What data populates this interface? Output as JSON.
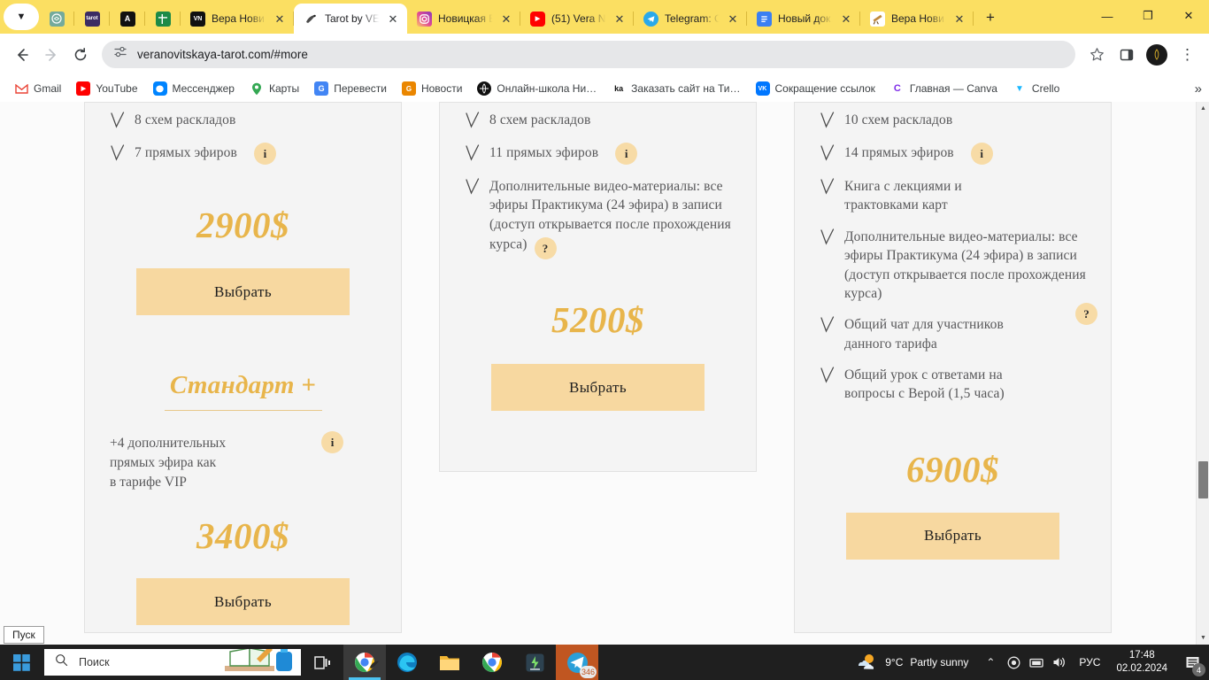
{
  "browser": {
    "tab_list_dropdown": "tab-search",
    "mini_tabs": [
      {
        "name": "chatgpt",
        "letter": "",
        "bg": "#74aa9c"
      },
      {
        "name": "notion-dark",
        "letter": "",
        "bg": "#3b2c63"
      },
      {
        "name": "adobe-acrobat",
        "letter": "A",
        "bg": "#111111"
      },
      {
        "name": "excel",
        "letter": "",
        "bg": "#1d8a47"
      }
    ],
    "tabs": [
      {
        "title": "Вера Нови…",
        "favicon_letter": "VN",
        "favicon_bg": "#111111",
        "active": false
      },
      {
        "title": "Tarot by VE…",
        "favicon_letter": "",
        "favicon_bg": "#ffffff",
        "active": true
      },
      {
        "title": "Новицкая В…",
        "favicon_letter": "",
        "favicon_bg": "#e1306c",
        "active": false
      },
      {
        "title": "(51) Vera N…",
        "favicon_letter": "",
        "favicon_bg": "#ff0000",
        "active": false
      },
      {
        "title": "Telegram: C…",
        "favicon_letter": "",
        "favicon_bg": "#29a9eb",
        "active": false
      },
      {
        "title": "Новый док…",
        "favicon_letter": "",
        "favicon_bg": "#3b7ff2",
        "active": false
      },
      {
        "title": "Вера Нови…",
        "favicon_letter": "",
        "favicon_bg": "#ffffff",
        "active": false
      }
    ],
    "tab_close_glyph": "✕",
    "new_tab_glyph": "+",
    "window_controls": {
      "minimize": "—",
      "maximize": "❐",
      "close": "✕"
    },
    "nav": {
      "back": "←",
      "forward": "→",
      "reload": "⟳"
    },
    "omnibox": {
      "url": "veranovitskaya-tarot.com/#more",
      "site_settings_icon": "tune-icon",
      "star": "☆"
    },
    "side_panel_icon": "side-panel-icon",
    "menu_icon": "⋮",
    "bookmarks": [
      {
        "label": "Gmail",
        "letter": "M",
        "bg": "#ffffff",
        "color": "#ea4335"
      },
      {
        "label": "YouTube",
        "letter": "▶",
        "bg": "#ff0000",
        "color": "#ffffff"
      },
      {
        "label": "Мессенджер",
        "letter": "",
        "bg": "#ffffff",
        "color": "#0084ff"
      },
      {
        "label": "Карты",
        "letter": "",
        "bg": "#ffffff",
        "color": "#34a853"
      },
      {
        "label": "Перевести",
        "letter": "G",
        "bg": "#4285f4",
        "color": "#ffffff"
      },
      {
        "label": "Новости",
        "letter": "G",
        "bg": "#ea8600",
        "color": "#ffffff"
      },
      {
        "label": "Онлайн-школа Ни…",
        "letter": "",
        "bg": "#111111",
        "color": "#ffffff"
      },
      {
        "label": "Заказать сайт на Ти…",
        "letter": "ka",
        "bg": "#ffffff",
        "color": "#111111"
      },
      {
        "label": "Сокращение ссылок",
        "letter": "VK",
        "bg": "#0077ff",
        "color": "#ffffff"
      },
      {
        "label": "Главная — Canva",
        "letter": "C",
        "bg": "#ffffff",
        "color": "#7d2ae8"
      },
      {
        "label": "Crello",
        "letter": "▼",
        "bg": "#ffffff",
        "color": "#1ab7ff"
      }
    ],
    "bookmarks_overflow": "»"
  },
  "page": {
    "colors": {
      "card_bg": "#f4f4f4",
      "card_border": "#e2e2e2",
      "price_gold": "#e8b54b",
      "cta_bg": "#f7d8a0",
      "badge_bg": "#f7dba6"
    },
    "check_icon": "checkmark-icon",
    "columns": [
      {
        "id": "column-standard",
        "features": [
          {
            "text": "8 схем раскладов",
            "badge": null
          },
          {
            "text": "7 прямых эфиров",
            "badge": "i"
          }
        ],
        "price": "2900$",
        "cta": "Выбрать",
        "subplan": {
          "title": "Стандарт +",
          "note": "+4 дополнительных\nпрямых эфира как\nв тарифе VIP",
          "badge": "i",
          "price": "3400$",
          "cta": "Выбрать"
        }
      },
      {
        "id": "column-premium",
        "features": [
          {
            "text": "8 схем раскладов",
            "badge": null
          },
          {
            "text": "11 прямых эфиров",
            "badge": "i"
          },
          {
            "text": "Дополнительные видео-материалы: все эфиры Практикума (24 эфира) в записи (доступ открывается после прохождения курса)",
            "badge": "?"
          }
        ],
        "price": "5200$",
        "cta": "Выбрать"
      },
      {
        "id": "column-vip",
        "features": [
          {
            "text": "10 схем раскладов",
            "badge": null
          },
          {
            "text": "14 прямых эфиров",
            "badge": "i"
          },
          {
            "text": "Книга с лекциями и трактовками карт",
            "badge": null
          },
          {
            "text": "Дополнительные видео-материалы: все эфиры Практикума (24 эфира) в записи (доступ открывается после прохождения курса)",
            "badge": null
          },
          {
            "text": "Общий чат для участников данного тарифа",
            "badge": "?"
          },
          {
            "text": "Общий урок с ответами на вопросы с Верой (1,5 часа)",
            "badge": null
          }
        ],
        "price": "6900$",
        "cta": "Выбрать"
      }
    ],
    "scrollbar": {
      "up_arrow": "▲",
      "down_arrow": "▼"
    }
  },
  "taskbar": {
    "start_tooltip": "Пуск",
    "start_icon": "windows-logo-icon",
    "search_placeholder": "Поиск",
    "search_icon": "search-icon",
    "items": [
      {
        "name": "task-view",
        "icon": "task-view-icon",
        "active": false
      },
      {
        "name": "chrome-active",
        "icon": "chrome-icon",
        "active": true
      },
      {
        "name": "edge",
        "icon": "edge-icon",
        "active": false
      },
      {
        "name": "file-explorer",
        "icon": "folder-icon",
        "active": false
      },
      {
        "name": "chrome",
        "icon": "chrome-icon",
        "active": false
      },
      {
        "name": "notes-app",
        "icon": "notes-icon",
        "active": false
      },
      {
        "name": "telegram",
        "icon": "telegram-icon",
        "active": false,
        "badge": "346"
      }
    ],
    "weather": {
      "temp": "9°C",
      "condition": "Partly sunny",
      "icon": "partly-sunny-icon"
    },
    "tray": {
      "overflow": "⌃",
      "onedrive_icon": "onedrive-icon",
      "network_icon": "network-icon",
      "volume_icon": "volume-icon",
      "language": "РУС"
    },
    "clock": {
      "time": "17:48",
      "date": "02.02.2024"
    },
    "notifications": {
      "icon": "notification-icon",
      "count": "4"
    }
  }
}
